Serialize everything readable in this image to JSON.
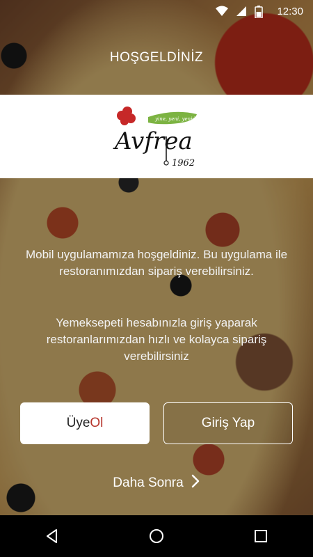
{
  "status_bar": {
    "time": "12:30",
    "icons": [
      "wifi-icon",
      "signal-icon",
      "battery-icon"
    ]
  },
  "welcome_title": "HOŞGELDİNİZ",
  "logo": {
    "brand": "Avfrea",
    "year": "1962",
    "tagline": "yine, yeni, yeniden",
    "colors": {
      "red": "#c62828",
      "green": "#7cb342",
      "black": "#111111"
    }
  },
  "intro_text": "Mobil uygulamamıza hoşgeldiniz. Bu uygulama ile restoranımızdan sipariş verebilirsiniz.",
  "intro_text2": "Yemeksepeti hesabınızla giriş yaparak restoranlarımızdan hızlı ve kolayca sipariş verebilirsiniz",
  "buttons": {
    "signup_prefix": "Üye ",
    "signup_accent": "Ol",
    "login": "Giriş Yap"
  },
  "later_link": "Daha Sonra",
  "nav": {
    "icons": [
      "back-icon",
      "home-icon",
      "recents-icon"
    ]
  }
}
